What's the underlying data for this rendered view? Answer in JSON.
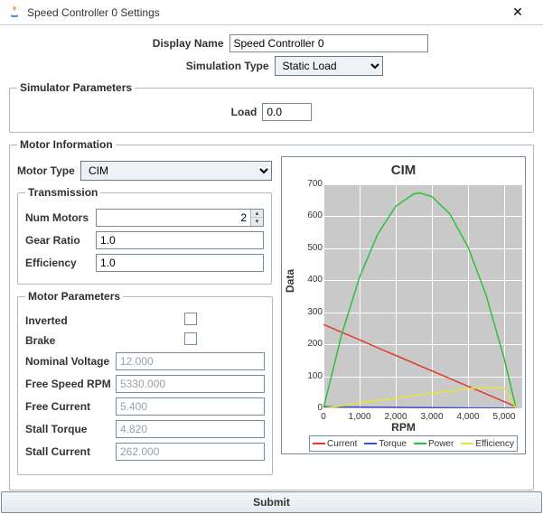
{
  "window": {
    "title": "Speed Controller 0 Settings",
    "close_glyph": "✕"
  },
  "form": {
    "display_name_label": "Display Name",
    "display_name_value": "Speed Controller 0",
    "sim_type_label": "Simulation Type",
    "sim_type_value": "Static Load"
  },
  "sim_params": {
    "legend": "Simulator Parameters",
    "load_label": "Load",
    "load_value": "0.0"
  },
  "motor_info": {
    "legend": "Motor Information",
    "motor_type_label": "Motor Type",
    "motor_type_value": "CIM"
  },
  "transmission": {
    "legend": "Transmission",
    "num_motors_label": "Num Motors",
    "num_motors_value": "2",
    "gear_ratio_label": "Gear Ratio",
    "gear_ratio_value": "1.0",
    "efficiency_label": "Efficiency",
    "efficiency_value": "1.0"
  },
  "motor_params": {
    "legend": "Motor Parameters",
    "inverted_label": "Inverted",
    "inverted_checked": false,
    "brake_label": "Brake",
    "brake_checked": false,
    "nominal_voltage_label": "Nominal Voltage",
    "nominal_voltage_value": "12.000",
    "free_speed_label": "Free Speed RPM",
    "free_speed_value": "5330.000",
    "free_current_label": "Free Current",
    "free_current_value": "5.400",
    "stall_torque_label": "Stall Torque",
    "stall_torque_value": "4.820",
    "stall_current_label": "Stall Current",
    "stall_current_value": "262.000"
  },
  "chart": {
    "title": "CIM",
    "xlabel": "RPM",
    "ylabel": "Data",
    "legend_current": "Current",
    "legend_torque": "Torque",
    "legend_power": "Power",
    "legend_efficiency": "Efficiency",
    "colors": {
      "current": "#e23b2e",
      "torque": "#3b53c4",
      "power": "#2fbf3a",
      "efficiency": "#e8e33a",
      "grid": "#ffffff",
      "plot_bg": "#c9c9c9"
    }
  },
  "chart_data": {
    "type": "line",
    "title": "CIM",
    "xlabel": "RPM",
    "ylabel": "Data",
    "xlim": [
      0,
      5500
    ],
    "ylim": [
      0,
      700
    ],
    "x_ticks": [
      0,
      1000,
      2000,
      3000,
      4000,
      5000
    ],
    "y_ticks": [
      0,
      100,
      200,
      300,
      400,
      500,
      600,
      700
    ],
    "x": [
      0,
      500,
      1000,
      1500,
      2000,
      2500,
      2665,
      3000,
      3500,
      4000,
      4500,
      5000,
      5330
    ],
    "series": [
      {
        "name": "Current",
        "color": "#e23b2e",
        "values": [
          262,
          238,
          214,
          189,
          165,
          141,
          133,
          117,
          93,
          69,
          45,
          21,
          5
        ]
      },
      {
        "name": "Torque",
        "color": "#3b53c4",
        "values": [
          4.82,
          4.37,
          3.92,
          3.46,
          3.01,
          2.56,
          2.41,
          2.11,
          1.66,
          1.2,
          0.75,
          0.3,
          0.0
        ]
      },
      {
        "name": "Power",
        "color": "#2fbf3a",
        "values": [
          0,
          229,
          410,
          544,
          631,
          670,
          673,
          662,
          607,
          504,
          354,
          156,
          0
        ]
      },
      {
        "name": "Efficiency",
        "color": "#e8e33a",
        "values": [
          0,
          8,
          16,
          24,
          32,
          40,
          42,
          47,
          54,
          61,
          66,
          63,
          0
        ]
      }
    ]
  },
  "submit_label": "Submit"
}
